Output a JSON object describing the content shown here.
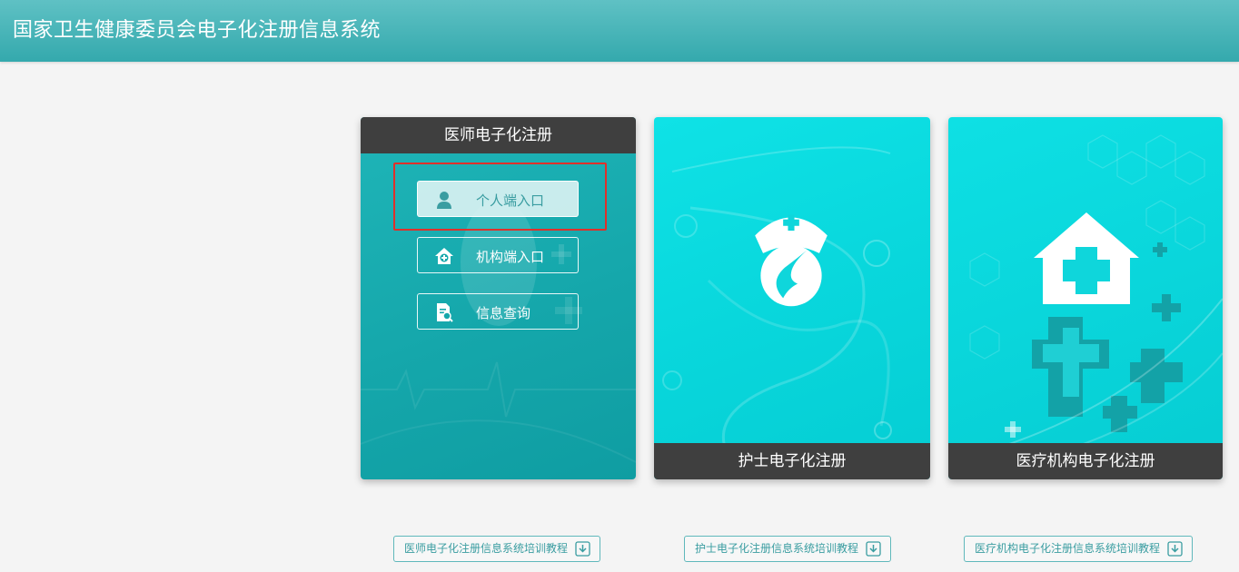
{
  "header": {
    "title": "国家卫生健康委员会电子化注册信息系统"
  },
  "cards": {
    "doctor": {
      "title": "医师电子化注册",
      "entries": {
        "personal": "个人端入口",
        "organization": "机构端入口",
        "query": "信息查询"
      }
    },
    "nurse": {
      "title": "护士电子化注册"
    },
    "organization": {
      "title": "医疗机构电子化注册"
    }
  },
  "tutorials": {
    "doctor": "医师电子化注册信息系统培训教程",
    "nurse": "护士电子化注册信息系统培训教程",
    "organization": "医疗机构电子化注册信息系统培训教程"
  },
  "icons": {
    "personal": "user-icon",
    "organization": "hospital-house-icon",
    "query": "document-search-icon",
    "nurse": "nurse-cap-icon",
    "org": "house-cross-icon",
    "download": "download-icon"
  },
  "colors": {
    "header": "#34a9ad",
    "doctor_card": "#15a7ab",
    "cyan_card": "#09d7dc",
    "dark_bar": "#3f3f3f",
    "highlight": "#e0302a"
  }
}
